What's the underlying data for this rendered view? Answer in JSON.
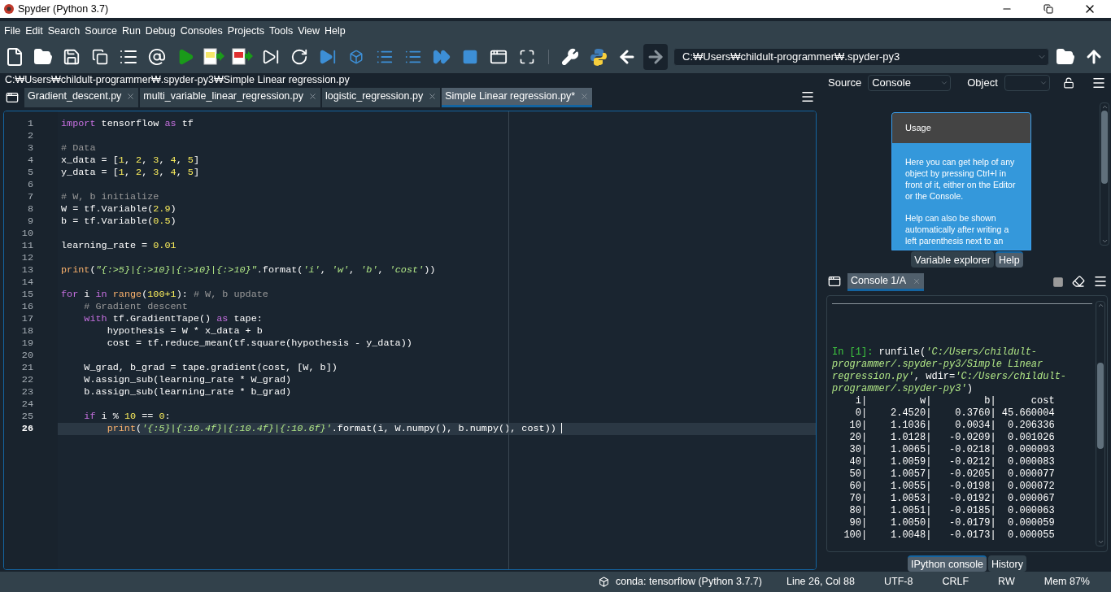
{
  "window": {
    "title": "Spyder (Python 3.7)"
  },
  "menu": [
    "File",
    "Edit",
    "Search",
    "Source",
    "Run",
    "Debug",
    "Consoles",
    "Projects",
    "Tools",
    "View",
    "Help"
  ],
  "toolbar": {
    "path": "C:₩Users₩childult-programmer₩.spyder-py3"
  },
  "file_path": "C:₩Users₩childult-programmer₩.spyder-py3₩Simple Linear regression.py",
  "editor": {
    "tabs": [
      {
        "label": "Gradient_descent.py",
        "selected": false
      },
      {
        "label": "multi_variable_linear_regression.py",
        "selected": false
      },
      {
        "label": "logistic_regression.py",
        "selected": false
      },
      {
        "label": "Simple Linear regression.py*",
        "selected": true
      }
    ],
    "lines": [
      {
        "number": "1",
        "current": false,
        "tokens": [
          {
            "kind": "keyword",
            "text": "import"
          },
          {
            "kind": "plain",
            "text": " tensorflow "
          },
          {
            "kind": "keyword",
            "text": "as"
          },
          {
            "kind": "plain",
            "text": " tf"
          }
        ]
      },
      {
        "number": "2",
        "current": false
      },
      {
        "number": "3",
        "current": false,
        "tokens": [
          {
            "kind": "comment",
            "text": "# Data"
          }
        ]
      },
      {
        "number": "4",
        "current": false,
        "tokens": [
          {
            "kind": "plain",
            "text": "x_data = ["
          },
          {
            "kind": "number",
            "text": "1"
          },
          {
            "kind": "plain",
            "text": ", "
          },
          {
            "kind": "number",
            "text": "2"
          },
          {
            "kind": "plain",
            "text": ", "
          },
          {
            "kind": "number",
            "text": "3"
          },
          {
            "kind": "plain",
            "text": ", "
          },
          {
            "kind": "number",
            "text": "4"
          },
          {
            "kind": "plain",
            "text": ", "
          },
          {
            "kind": "number",
            "text": "5"
          },
          {
            "kind": "plain",
            "text": "]"
          }
        ]
      },
      {
        "number": "5",
        "current": false,
        "tokens": [
          {
            "kind": "plain",
            "text": "y_data = ["
          },
          {
            "kind": "number",
            "text": "1"
          },
          {
            "kind": "plain",
            "text": ", "
          },
          {
            "kind": "number",
            "text": "2"
          },
          {
            "kind": "plain",
            "text": ", "
          },
          {
            "kind": "number",
            "text": "3"
          },
          {
            "kind": "plain",
            "text": ", "
          },
          {
            "kind": "number",
            "text": "4"
          },
          {
            "kind": "plain",
            "text": ", "
          },
          {
            "kind": "number",
            "text": "5"
          },
          {
            "kind": "plain",
            "text": "]"
          }
        ]
      },
      {
        "number": "6",
        "current": false
      },
      {
        "number": "7",
        "current": false,
        "tokens": [
          {
            "kind": "comment",
            "text": "# W, b initialize"
          }
        ]
      },
      {
        "number": "8",
        "current": false,
        "tokens": [
          {
            "kind": "plain",
            "text": "W = tf.Variable("
          },
          {
            "kind": "number",
            "text": "2.9"
          },
          {
            "kind": "plain",
            "text": ")"
          }
        ]
      },
      {
        "number": "9",
        "current": false,
        "tokens": [
          {
            "kind": "plain",
            "text": "b = tf.Variable("
          },
          {
            "kind": "number",
            "text": "0.5"
          },
          {
            "kind": "plain",
            "text": ")"
          }
        ]
      },
      {
        "number": "10",
        "current": false
      },
      {
        "number": "11",
        "current": false,
        "tokens": [
          {
            "kind": "plain",
            "text": "learning_rate = "
          },
          {
            "kind": "number",
            "text": "0.01"
          }
        ]
      },
      {
        "number": "12",
        "current": false
      },
      {
        "number": "13",
        "current": false,
        "tokens": [
          {
            "kind": "builtin",
            "text": "print"
          },
          {
            "kind": "plain",
            "text": "("
          },
          {
            "kind": "string",
            "text": "\"{:>5}|{:>10}|{:>10}|{:>10}\""
          },
          {
            "kind": "plain",
            "text": ".format("
          },
          {
            "kind": "string",
            "text": "'i'"
          },
          {
            "kind": "plain",
            "text": ", "
          },
          {
            "kind": "string",
            "text": "'w'"
          },
          {
            "kind": "plain",
            "text": ", "
          },
          {
            "kind": "string",
            "text": "'b'"
          },
          {
            "kind": "plain",
            "text": ", "
          },
          {
            "kind": "string",
            "text": "'cost'"
          },
          {
            "kind": "plain",
            "text": "))"
          }
        ]
      },
      {
        "number": "14",
        "current": false
      },
      {
        "number": "15",
        "current": false,
        "tokens": [
          {
            "kind": "keyword",
            "text": "for"
          },
          {
            "kind": "plain",
            "text": " i "
          },
          {
            "kind": "keyword",
            "text": "in"
          },
          {
            "kind": "builtin",
            "text": " range"
          },
          {
            "kind": "plain",
            "text": "("
          },
          {
            "kind": "number",
            "text": "100+1"
          },
          {
            "kind": "plain",
            "text": "): "
          },
          {
            "kind": "comment",
            "text": "# W, b update"
          }
        ]
      },
      {
        "number": "16",
        "current": false,
        "tokens": [
          {
            "kind": "comment",
            "text": "    # Gradient descent"
          }
        ]
      },
      {
        "number": "17",
        "current": false,
        "tokens": [
          {
            "kind": "keyword",
            "text": "    with"
          },
          {
            "kind": "plain",
            "text": " tf.GradientTape() "
          },
          {
            "kind": "keyword",
            "text": "as"
          },
          {
            "kind": "plain",
            "text": " tape:"
          }
        ]
      },
      {
        "number": "18",
        "current": false,
        "tokens": [
          {
            "kind": "plain",
            "text": "        hypothesis = W * x_data + b"
          }
        ]
      },
      {
        "number": "19",
        "current": false,
        "tokens": [
          {
            "kind": "plain",
            "text": "        cost = tf.reduce_mean(tf.square(hypothesis - y_data))"
          }
        ]
      },
      {
        "number": "20",
        "current": false
      },
      {
        "number": "21",
        "current": false,
        "tokens": [
          {
            "kind": "plain",
            "text": "    W_grad, b_grad = tape.gradient(cost, [W, b])"
          }
        ]
      },
      {
        "number": "22",
        "current": false,
        "tokens": [
          {
            "kind": "plain",
            "text": "    W.assign_sub(learning_rate * W_grad)"
          }
        ]
      },
      {
        "number": "23",
        "current": false,
        "tokens": [
          {
            "kind": "plain",
            "text": "    b.assign_sub(learning_rate * b_grad)"
          }
        ]
      },
      {
        "number": "24",
        "current": false
      },
      {
        "number": "25",
        "current": false,
        "tokens": [
          {
            "kind": "keyword",
            "text": "    if"
          },
          {
            "kind": "plain",
            "text": " i % "
          },
          {
            "kind": "number",
            "text": "10"
          },
          {
            "kind": "plain",
            "text": " == "
          },
          {
            "kind": "number",
            "text": "0"
          },
          {
            "kind": "plain",
            "text": ":"
          }
        ]
      },
      {
        "number": "26",
        "current": true,
        "tokens": [
          {
            "kind": "builtin",
            "text": "        print"
          },
          {
            "kind": "plain",
            "text": "("
          },
          {
            "kind": "string",
            "text": "'{:5}|{:10.4f}|{:10.4f}|{:10.6f}'"
          },
          {
            "kind": "plain",
            "text": ".format(i, W.numpy(), b.numpy(), cost))"
          }
        ]
      }
    ]
  },
  "help": {
    "source_label": "Source",
    "source_value": "Console",
    "object_label": "Object",
    "card": {
      "title": "Usage",
      "paragraphs": [
        "Here you can get help of any object by pressing Ctrl+I in front of it, either on the Editor or the Console.",
        "Help can also be shown automatically after writing a left parenthesis next to an"
      ]
    },
    "tabs": [
      {
        "label": "Variable explorer",
        "selected": false
      },
      {
        "label": "Help",
        "selected": true
      }
    ]
  },
  "console": {
    "tabs": [
      {
        "label": "Console 1/A",
        "selected": true
      }
    ],
    "prompt": "In [1]:",
    "command": [
      {
        "kind": "plain",
        "text": " runfile("
      },
      {
        "kind": "string",
        "text": "'C:/Users/childult-programmer/.spyder-py3/Simple Linear regression.py'"
      },
      {
        "kind": "plain",
        "text": ", wdir="
      },
      {
        "kind": "string",
        "text": "'C:/Users/childult-programmer/.spyder-py3'"
      },
      {
        "kind": "plain",
        "text": ")"
      }
    ],
    "output": [
      "    i|         w|         b|      cost",
      "    0|    2.4520|    0.3760| 45.660004",
      "   10|    1.1036|    0.0034|  0.206336",
      "   20|    1.0128|   -0.0209|  0.001026",
      "   30|    1.0065|   -0.0218|  0.000093",
      "   40|    1.0059|   -0.0212|  0.000083",
      "   50|    1.0057|   -0.0205|  0.000077",
      "   60|    1.0055|   -0.0198|  0.000072",
      "   70|    1.0053|   -0.0192|  0.000067",
      "   80|    1.0051|   -0.0185|  0.000063",
      "   90|    1.0050|   -0.0179|  0.000059",
      "  100|    1.0048|   -0.0173|  0.000055"
    ],
    "pane_tabs": [
      {
        "label": "IPython console",
        "selected": true
      },
      {
        "label": "History",
        "selected": false
      }
    ]
  },
  "status_bar": {
    "env": "conda: tensorflow (Python 3.7.7)",
    "position": "Line 26, Col 88",
    "encoding": "UTF-8",
    "eol": "CRLF",
    "permissions": "RW",
    "memory": "Mem 87%"
  }
}
